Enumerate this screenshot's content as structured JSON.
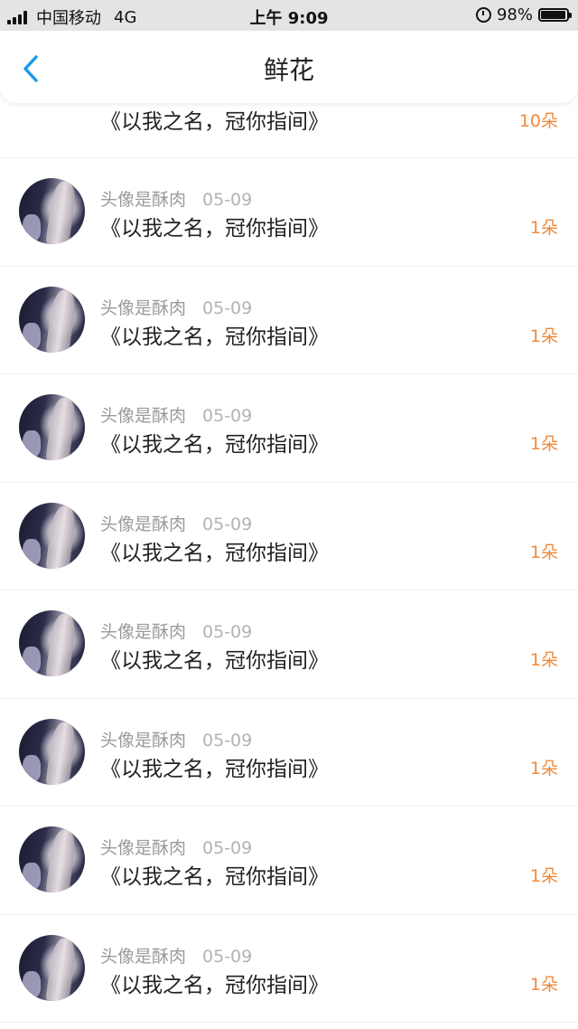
{
  "status_bar": {
    "carrier": "中国移动",
    "network": "4G",
    "time": "上午 9:09",
    "battery": "98%"
  },
  "nav": {
    "title": "鲜花"
  },
  "list": [
    {
      "name": "",
      "date": "",
      "title": "《以我之名，冠你指间》",
      "count": "10朵"
    },
    {
      "name": "头像是酥肉",
      "date": "05-09",
      "title": "《以我之名，冠你指间》",
      "count": "1朵"
    },
    {
      "name": "头像是酥肉",
      "date": "05-09",
      "title": "《以我之名，冠你指间》",
      "count": "1朵"
    },
    {
      "name": "头像是酥肉",
      "date": "05-09",
      "title": "《以我之名，冠你指间》",
      "count": "1朵"
    },
    {
      "name": "头像是酥肉",
      "date": "05-09",
      "title": "《以我之名，冠你指间》",
      "count": "1朵"
    },
    {
      "name": "头像是酥肉",
      "date": "05-09",
      "title": "《以我之名，冠你指间》",
      "count": "1朵"
    },
    {
      "name": "头像是酥肉",
      "date": "05-09",
      "title": "《以我之名，冠你指间》",
      "count": "1朵"
    },
    {
      "name": "头像是酥肉",
      "date": "05-09",
      "title": "《以我之名，冠你指间》",
      "count": "1朵"
    },
    {
      "name": "头像是酥肉",
      "date": "05-09",
      "title": "《以我之名，冠你指间》",
      "count": "1朵"
    }
  ],
  "colors": {
    "accent": "#1a9be6",
    "count": "#f08a3c",
    "meta": "#9b9b9b"
  },
  "icons": {
    "back": "chevron-left-icon",
    "alarm": "alarm-icon",
    "battery": "battery-icon",
    "signal": "signal-icon"
  }
}
